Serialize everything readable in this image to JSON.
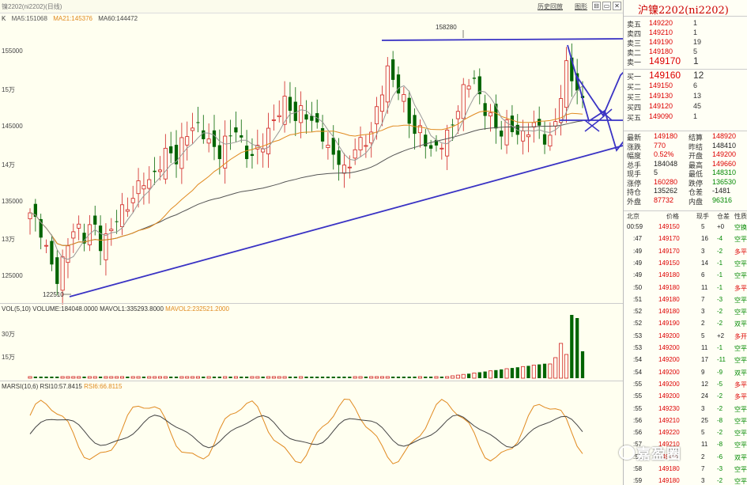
{
  "topbar": {
    "code_label": "镍2202(ni2202)(日线)",
    "btn_history": "历史回放",
    "btn_chart": "图形",
    "win_btns": [
      "⊟",
      "▭",
      "✕"
    ]
  },
  "ma_legend": {
    "prefix": "K",
    "ma5": "MA5:151068",
    "ma21": "MA21:145376",
    "ma60": "MA60:144472"
  },
  "colors": {
    "ma5": "#777777",
    "ma21": "#e08a20",
    "ma60": "#555555",
    "up": "#d02020",
    "down": "#006400",
    "trend": "#3a33c4"
  },
  "y_axis": [
    "155000",
    "15万",
    "145000",
    "14万",
    "135000",
    "13万",
    "125000"
  ],
  "price_labels": {
    "high": "158280",
    "low": "122510"
  },
  "vol_legend": {
    "name": "VOL(5,10)",
    "volume": "VOLUME:184048.0000",
    "mavol1": "MAVOL1:335293.8000",
    "mavol2": "MAVOL2:232521.2000"
  },
  "vol_axis": [
    "30万",
    "15万"
  ],
  "rsi_legend": {
    "name": "MARSI(10,6)",
    "rsi10": "RSI10:57.8415",
    "rsi6": "RSI6:66.8115"
  },
  "side": {
    "title": "沪镍2202(ni2202)",
    "asks": [
      {
        "label": "卖五",
        "price": "149220",
        "vol": "1"
      },
      {
        "label": "卖四",
        "price": "149210",
        "vol": "1"
      },
      {
        "label": "卖三",
        "price": "149190",
        "vol": "19"
      },
      {
        "label": "卖二",
        "price": "149180",
        "vol": "5"
      },
      {
        "label": "卖一",
        "price": "149170",
        "vol": "1"
      }
    ],
    "bids": [
      {
        "label": "买一",
        "price": "149160",
        "vol": "12"
      },
      {
        "label": "买二",
        "price": "149150",
        "vol": "6"
      },
      {
        "label": "买三",
        "price": "149130",
        "vol": "13"
      },
      {
        "label": "买四",
        "price": "149120",
        "vol": "45"
      },
      {
        "label": "买五",
        "price": "149090",
        "vol": "1"
      }
    ],
    "stats": [
      [
        "最新",
        "149180",
        "结算",
        "148920"
      ],
      [
        "涨跌",
        "770",
        "昨结",
        "148410"
      ],
      [
        "幅度",
        "0.52%",
        "开盘",
        "149200"
      ],
      [
        "总手",
        "184048",
        "最高",
        "149660"
      ],
      [
        "现手",
        "5",
        "最低",
        "148310"
      ],
      [
        "涨停",
        "160280",
        "跌停",
        "136530"
      ],
      [
        "持仓",
        "135262",
        "仓差",
        "-1481"
      ],
      [
        "外盘",
        "87732",
        "内盘",
        "96316"
      ]
    ],
    "ticks_header": [
      "北京",
      "价格",
      "现手",
      "仓差",
      "性质"
    ],
    "first_time": "00:59",
    "ticks": [
      [
        "00:59",
        "149150",
        "5",
        "+0",
        "空换"
      ],
      [
        ":47",
        "149170",
        "16",
        "-4",
        "空平"
      ],
      [
        ":49",
        "149170",
        "3",
        "-2",
        "多平"
      ],
      [
        ":49",
        "149150",
        "14",
        "-1",
        "空平"
      ],
      [
        ":49",
        "149180",
        "6",
        "-1",
        "空平"
      ],
      [
        ":50",
        "149180",
        "11",
        "-1",
        "多平"
      ],
      [
        ":51",
        "149180",
        "7",
        "-3",
        "空平"
      ],
      [
        ":52",
        "149180",
        "3",
        "-2",
        "空平"
      ],
      [
        ":52",
        "149190",
        "2",
        "-2",
        "双平"
      ],
      [
        ":53",
        "149200",
        "5",
        "+2",
        "多开"
      ],
      [
        ":53",
        "149200",
        "11",
        "-1",
        "空平"
      ],
      [
        ":54",
        "149200",
        "17",
        "-11",
        "空平"
      ],
      [
        ":54",
        "149200",
        "9",
        "-9",
        "双平"
      ],
      [
        ":55",
        "149200",
        "12",
        "-5",
        "多平"
      ],
      [
        ":55",
        "149200",
        "24",
        "-2",
        "多平"
      ],
      [
        ":55",
        "149230",
        "3",
        "-2",
        "空平"
      ],
      [
        ":56",
        "149210",
        "25",
        "-8",
        "空平"
      ],
      [
        ":56",
        "149220",
        "5",
        "-2",
        "空平"
      ],
      [
        ":57",
        "149210",
        "11",
        "-8",
        "空平"
      ],
      [
        ":57",
        "149190",
        "2",
        "-6",
        "双平"
      ],
      [
        ":58",
        "149180",
        "7",
        "-3",
        "空平"
      ],
      [
        ":59",
        "149180",
        "3",
        "-2",
        "空平"
      ]
    ]
  },
  "watermark": "嘉盈圈"
}
